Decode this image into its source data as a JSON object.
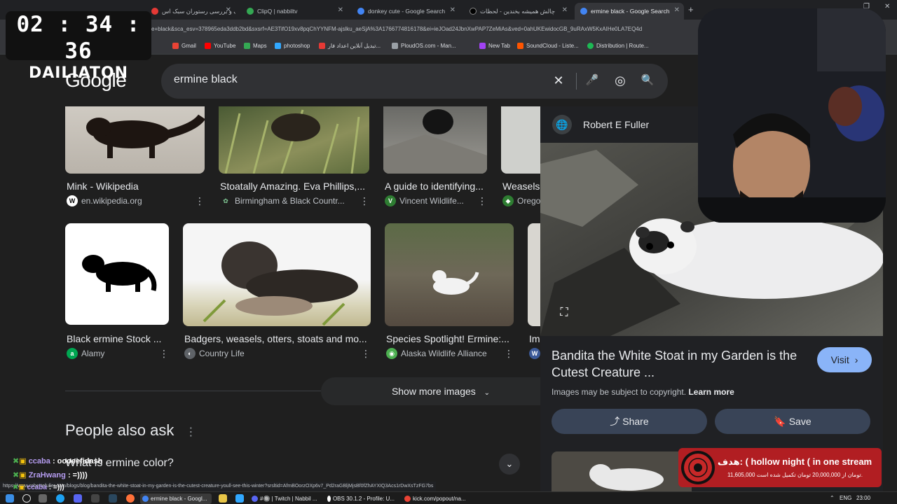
{
  "browser": {
    "tabs": [
      {
        "label": "اسپاف و بررسی رستوران سبک اس",
        "color": "#e53935"
      },
      {
        "label": "ClipQ | nabbiltv",
        "color": "#34a853"
      },
      {
        "label": "donkey cute - Google Search",
        "color": "#4285f4"
      },
      {
        "label": "چالش همیشه بخندین - لحظات",
        "color": "#000000"
      },
      {
        "label": "ermine black - Google Search",
        "color": "#4285f4",
        "active": true
      }
    ],
    "url": "e+black&sca_esv=378965eda3ddb2bd&sxsrf=AE3TifO19xv8pqChYYNFM-ajslku_aeSjA%3A1766774816178&ei=ieJOad24JbnXwPAP7ZeMiAs&ved=0ahUKEwidocGB_9uRAxW5KxAIHe0LA7EQ4d",
    "bookmarks": [
      {
        "label": "Gmail",
        "color": "#ea4335"
      },
      {
        "label": "YouTube",
        "color": "#ff0000"
      },
      {
        "label": "Maps",
        "color": "#34a853"
      },
      {
        "label": "photoshop",
        "color": "#31a8ff"
      },
      {
        "label": "تبدیل آنلاین اعداد فار...",
        "color": "#e53935"
      },
      {
        "label": "PloudOS.com - Man...",
        "color": "#9aa0a6"
      },
      {
        "label": "New Tab",
        "color": "#a142f4"
      },
      {
        "label": "SoundCloud - Liste...",
        "color": "#ff5500"
      },
      {
        "label": "Distribution | Route...",
        "color": "#1db954"
      }
    ]
  },
  "timer": {
    "time": "02 : 34 : 36",
    "label": "DAILIATON"
  },
  "google": {
    "logo": "Google",
    "query": "ermine black",
    "clear_icon": "✕",
    "mic_icon": "🎤",
    "lens_icon": "◎",
    "search_icon": "🔍"
  },
  "images_row1": [
    {
      "title": "Mink - Wikipedia",
      "source": "en.wikipedia.org",
      "fav": "W",
      "favcolor": "#ffffff"
    },
    {
      "title": "Stoatally Amazing. Eva Phillips,...",
      "source": "Birmingham & Black Countr...",
      "fav": "✿",
      "favcolor": "#2e7d32"
    },
    {
      "title": "A guide to identifying...",
      "source": "Vincent Wildlife...",
      "fav": "V",
      "favcolor": "#2e7d32"
    },
    {
      "title": "Weasels",
      "source": "Orego",
      "fav": "◆",
      "favcolor": "#2e7d32"
    }
  ],
  "images_row2": [
    {
      "title": "Black ermine Stock ...",
      "source": "Alamy",
      "fav": "a",
      "favcolor": "#00a651"
    },
    {
      "title": "Badgers, weasels, otters, stoats and mo...",
      "source": "Country Life",
      "fav": "◐",
      "favcolor": "#5f6368"
    },
    {
      "title": "Species Spotlight! Ermine:...",
      "source": "Alaska Wildlife Alliance",
      "fav": "◉",
      "favcolor": "#4caf50"
    },
    {
      "title": "Im",
      "source": "",
      "fav": "W",
      "favcolor": "#3b5998"
    }
  ],
  "show_more": "Show more images",
  "people_also_ask": {
    "heading": "People also ask",
    "question": "What is ermine color?"
  },
  "panel": {
    "source": "Robert E Fuller",
    "title": "Bandita the White Stoat in my Garden is the Cutest Creature ...",
    "visit": "Visit",
    "copyright": "Images may be subject to copyright.",
    "learn_more": "Learn more",
    "share": "Share",
    "save": "Save"
  },
  "donation_banner": {
    "title": "هدف: ( hollow night ( in one stream",
    "subtitle": "11,605,000 تومان از 20,000,000 تومان تکمیل شده است."
  },
  "chat": [
    {
      "user": "ccaba",
      "msg": ": oooeefidash"
    },
    {
      "user": "ZraHwang",
      "msg": ": =))))"
    },
    {
      "user": "ccaba",
      "msg": ": =)))"
    }
  ],
  "status_url": "https://www.robertefuller.com/blogs/blog/bandita-the-white-stoat-in-my-garden-is-the-cutest-creature-youll-see-this-winter?srsltid=AfmBOorzOXp6v7_Pd2raGBljMjsBf0fZhAYXIQ3Acs1rDwXsTzFG7bs",
  "taskbar": {
    "apps": [
      {
        "label": "ermine black - Googl...",
        "color": "#4285f4",
        "active": true
      },
      {
        "label": "#🔘 | Twitch | Nabbil ...",
        "color": "#5865f2"
      },
      {
        "label": "OBS 30.1.2 - Profile: U...",
        "color": "#ffffff"
      },
      {
        "label": "kick.com/popout/na...",
        "color": "#ea4335"
      }
    ],
    "lang": "ENG",
    "clock": "23:00"
  }
}
